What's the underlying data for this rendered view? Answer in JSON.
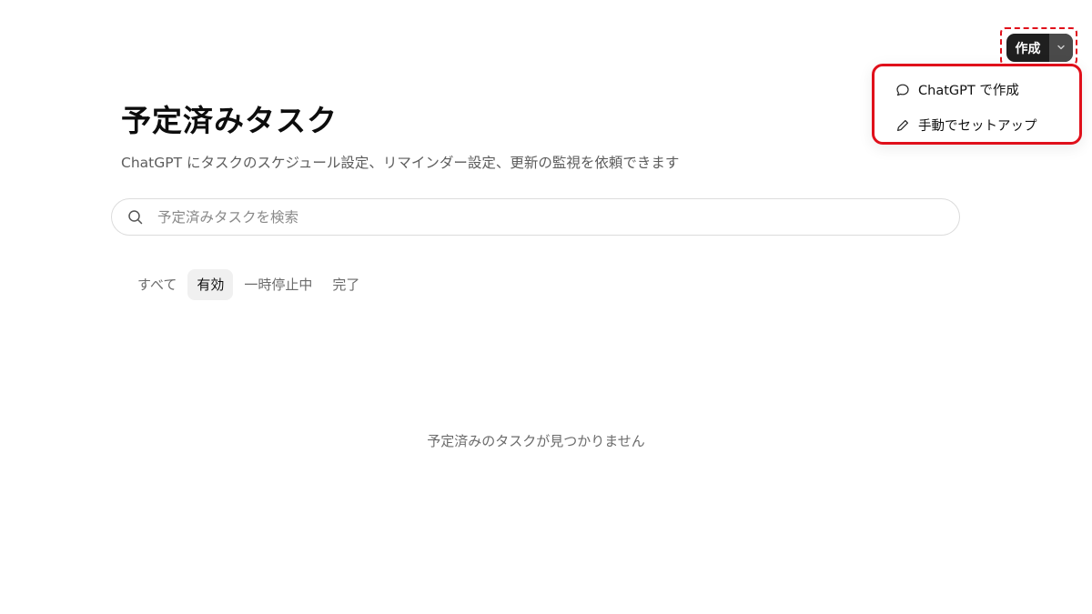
{
  "header": {
    "create_button_label": "作成",
    "create_menu": [
      {
        "label": "ChatGPT で作成",
        "icon": "chat-bubble-icon"
      },
      {
        "label": "手動でセットアップ",
        "icon": "pencil-icon"
      }
    ]
  },
  "main": {
    "title": "予定済みタスク",
    "subtitle": "ChatGPT にタスクのスケジュール設定、リマインダー設定、更新の監視を依頼できます",
    "search": {
      "placeholder": "予定済みタスクを検索",
      "value": ""
    },
    "tabs": [
      {
        "label": "すべて",
        "active": false
      },
      {
        "label": "有効",
        "active": true
      },
      {
        "label": "一時停止中",
        "active": false
      },
      {
        "label": "完了",
        "active": false
      }
    ],
    "empty_message": "予定済みのタスクが見つかりません"
  },
  "colors": {
    "highlight_red": "#e0101b",
    "create_button_bg": "#1f1f1f",
    "active_tab_bg": "#f0f0f0"
  }
}
